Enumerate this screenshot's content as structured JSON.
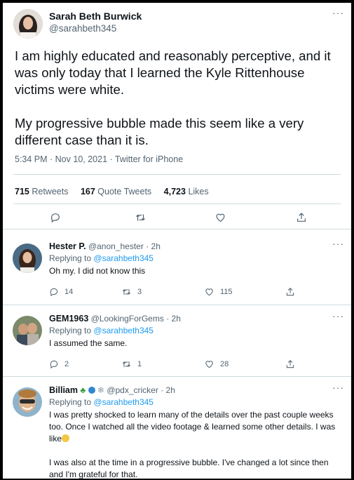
{
  "main_tweet": {
    "author_name": "Sarah Beth Burwick",
    "author_handle": "@sarahbeth345",
    "more_icon": "more-horizontal-icon",
    "paragraphs": [
      "I am highly educated and reasonably perceptive, and it was only today that I learned the Kyle Rittenhouse victims were white.",
      "My progressive bubble made this seem like a very different case than it is."
    ],
    "meta": "5:34 PM · Nov 10, 2021 · Twitter for iPhone",
    "stats": {
      "retweets_count": "715",
      "retweets_label": "Retweets",
      "quotes_count": "167",
      "quotes_label": "Quote Tweets",
      "likes_count": "4,723",
      "likes_label": "Likes"
    }
  },
  "replies": [
    {
      "name": "Hester P.",
      "handle": "@anon_hester",
      "time": "· 2h",
      "replying_prefix": "Replying to",
      "replying_to": "@sarahbeth345",
      "body": [
        "Oh my. I did not know this"
      ],
      "replies": "14",
      "retweets": "3",
      "likes": "115"
    },
    {
      "name": "GEM1963",
      "handle": "@LookingForGems",
      "time": "· 2h",
      "replying_prefix": "Replying to",
      "replying_to": "@sarahbeth345",
      "body": [
        "I assumed the same."
      ],
      "replies": "2",
      "retweets": "1",
      "likes": "28"
    },
    {
      "name": "Billiam",
      "handle": "@pdx_cricker",
      "time": "· 2h",
      "replying_prefix": "Replying to",
      "replying_to": "@sarahbeth345",
      "body": [
        "I was pretty shocked to learn many of the details over the past couple weeks too. Once I watched all the video footage & learned some other details. I was like",
        "I was also at the time in a progressive bubble. I've changed a lot since then and I'm grateful for that."
      ]
    }
  ],
  "colors": {
    "accent": "#1d9bf0",
    "text": "#0f1419",
    "secondary": "#536471",
    "border": "#cfd9de"
  }
}
